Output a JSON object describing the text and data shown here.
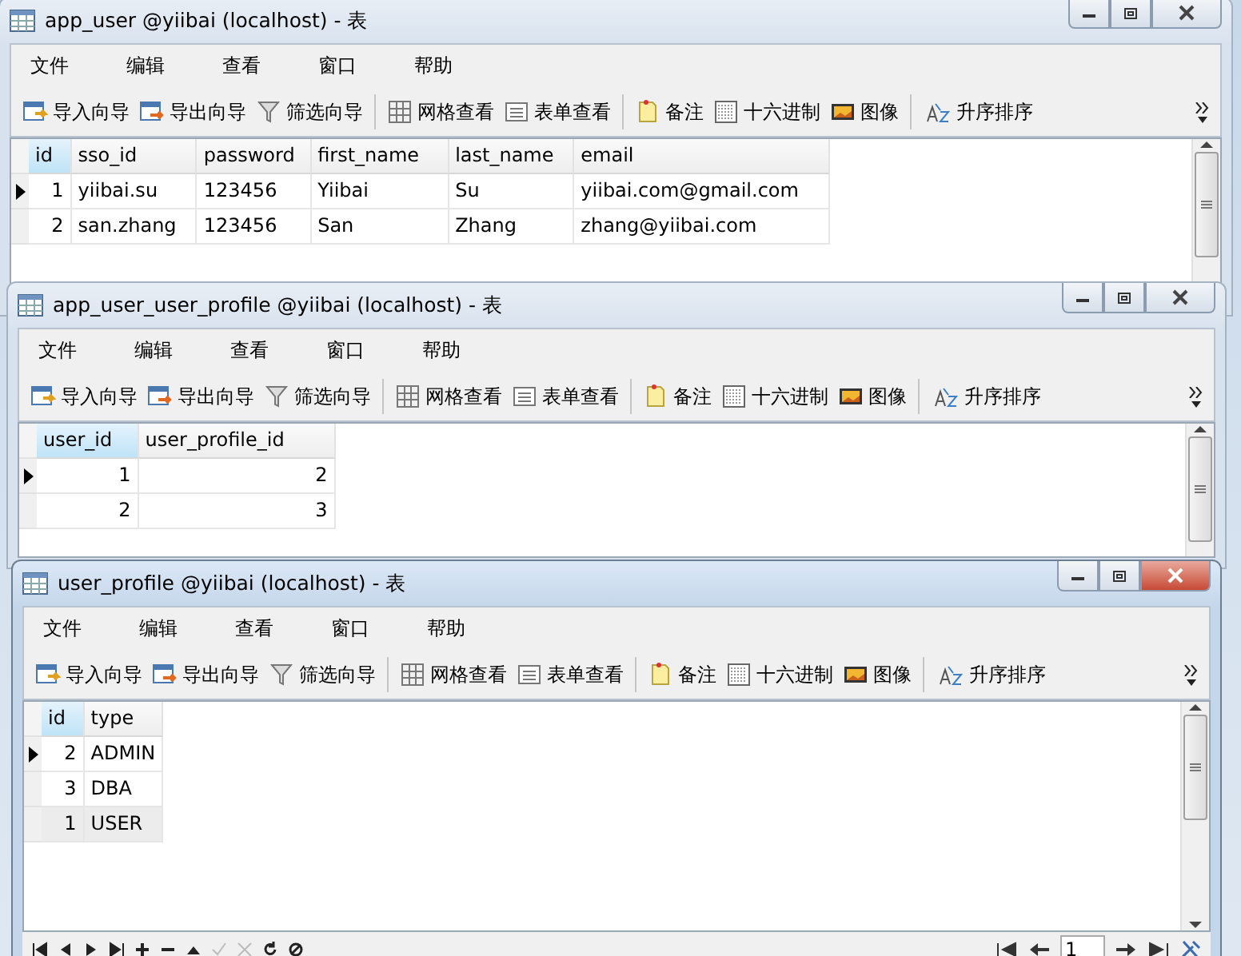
{
  "windows": [
    {
      "title": "app_user @yiibai (localhost) - 表",
      "active": false,
      "menu": [
        "文件",
        "编辑",
        "查看",
        "窗口",
        "帮助"
      ],
      "toolbar": [
        "导入向导",
        "导出向导",
        "筛选向导",
        "网格查看",
        "表单查看",
        "备注",
        "十六进制",
        "图像",
        "升序排序"
      ],
      "columns": [
        {
          "label": "id",
          "kind": "number",
          "selected": true
        },
        {
          "label": "sso_id",
          "kind": "text",
          "selected": false
        },
        {
          "label": "password",
          "kind": "text",
          "selected": false
        },
        {
          "label": "first_name",
          "kind": "text",
          "selected": false
        },
        {
          "label": "last_name",
          "kind": "text",
          "selected": false
        },
        {
          "label": "email",
          "kind": "text",
          "selected": false
        }
      ],
      "rows": [
        {
          "cells": [
            "1",
            "yiibai.su",
            "123456",
            "Yiibai",
            "Su",
            "yiibai.com@gmail.com"
          ],
          "current": true,
          "selected": false
        },
        {
          "cells": [
            "2",
            "san.zhang",
            "123456",
            "San",
            "Zhang",
            "zhang@yiibai.com"
          ],
          "current": false,
          "selected": false
        }
      ]
    },
    {
      "title": "app_user_user_profile @yiibai (localhost) - 表",
      "active": false,
      "menu": [
        "文件",
        "编辑",
        "查看",
        "窗口",
        "帮助"
      ],
      "toolbar": [
        "导入向导",
        "导出向导",
        "筛选向导",
        "网格查看",
        "表单查看",
        "备注",
        "十六进制",
        "图像",
        "升序排序"
      ],
      "columns": [
        {
          "label": "user_id",
          "kind": "number",
          "selected": true
        },
        {
          "label": "user_profile_id",
          "kind": "number",
          "selected": false
        }
      ],
      "rows": [
        {
          "cells": [
            "1",
            "2"
          ],
          "current": true,
          "selected": false
        },
        {
          "cells": [
            "2",
            "3"
          ],
          "current": false,
          "selected": false
        }
      ]
    },
    {
      "title": "user_profile @yiibai (localhost) - 表",
      "active": true,
      "menu": [
        "文件",
        "编辑",
        "查看",
        "窗口",
        "帮助"
      ],
      "toolbar": [
        "导入向导",
        "导出向导",
        "筛选向导",
        "网格查看",
        "表单查看",
        "备注",
        "十六进制",
        "图像",
        "升序排序"
      ],
      "columns": [
        {
          "label": "id",
          "kind": "number",
          "selected": true
        },
        {
          "label": "type",
          "kind": "text",
          "selected": false
        }
      ],
      "rows": [
        {
          "cells": [
            "2",
            "ADMIN"
          ],
          "current": true,
          "selected": false
        },
        {
          "cells": [
            "3",
            "DBA"
          ],
          "current": false,
          "selected": false
        },
        {
          "cells": [
            "1",
            "USER"
          ],
          "current": false,
          "selected": true
        }
      ],
      "page": "1"
    }
  ]
}
